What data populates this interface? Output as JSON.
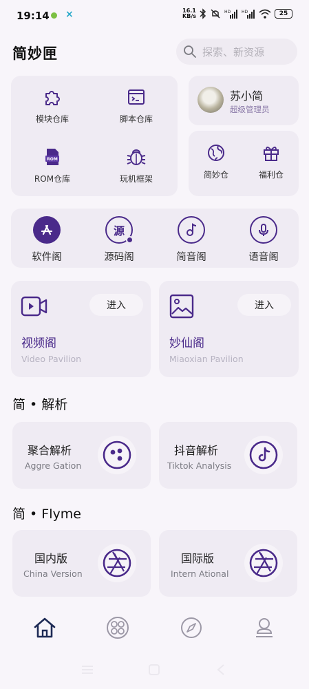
{
  "status_bar": {
    "time": "19:14",
    "net_speed_top": "16.1",
    "net_speed_bottom": "KB/s",
    "battery": "25",
    "icons": [
      "android-debug-icon",
      "close-x-icon",
      "bluetooth-icon",
      "mute-icon",
      "signal-hd-icon",
      "signal-hd-icon",
      "wifi-icon",
      "battery-icon"
    ]
  },
  "header": {
    "app_name": "简妙匣",
    "search_placeholder": "探索、新资源"
  },
  "quick_grid": [
    {
      "label": "模块仓库",
      "icon": "puzzle-icon"
    },
    {
      "label": "脚本仓库",
      "icon": "terminal-window-icon"
    },
    {
      "label": "ROM仓库",
      "icon": "rom-file-icon"
    },
    {
      "label": "玩机框架",
      "icon": "bug-icon"
    }
  ],
  "user": {
    "name": "苏小简",
    "role": "超级管理员"
  },
  "side_grid": [
    {
      "label": "简妙仓",
      "icon": "globe-icon"
    },
    {
      "label": "福利仓",
      "icon": "gift-icon"
    }
  ],
  "pavilions_row": [
    {
      "label": "软件阁",
      "icon": "app-store-icon"
    },
    {
      "label": "源码阁",
      "icon": "source-code-icon"
    },
    {
      "label": "简音阁",
      "icon": "music-note-icon"
    },
    {
      "label": "语音阁",
      "icon": "microphone-icon"
    }
  ],
  "pavilion_cards": [
    {
      "title": "视频阁",
      "subtitle": "Video Pavilion",
      "button": "进入",
      "icon": "video-camera-icon"
    },
    {
      "title": "妙仙阁",
      "subtitle": "Miaoxian Pavilion",
      "button": "进入",
      "icon": "image-icon"
    }
  ],
  "section_parse": {
    "title": "简 • 解析",
    "cards": [
      {
        "title": "聚合解析",
        "subtitle": "Aggre Gation",
        "icon": "aggregate-dots-icon"
      },
      {
        "title": "抖音解析",
        "subtitle": "Tiktok Analysis",
        "icon": "tiktok-icon"
      }
    ]
  },
  "section_flyme": {
    "title": "简 • Flyme",
    "cards": [
      {
        "title": "国内版",
        "subtitle": "China Version",
        "icon": "aperture-icon"
      },
      {
        "title": "国际版",
        "subtitle": "Intern Ational",
        "icon": "aperture-icon"
      }
    ]
  },
  "bottom_nav": [
    {
      "icon": "home-icon",
      "active": true
    },
    {
      "icon": "apps-circle-icon",
      "active": false
    },
    {
      "icon": "compass-icon",
      "active": false
    },
    {
      "icon": "profile-stamp-icon",
      "active": false
    }
  ],
  "colors": {
    "accent": "#4a2a8a",
    "background": "#f8f5fa",
    "card": "#efebf3"
  }
}
